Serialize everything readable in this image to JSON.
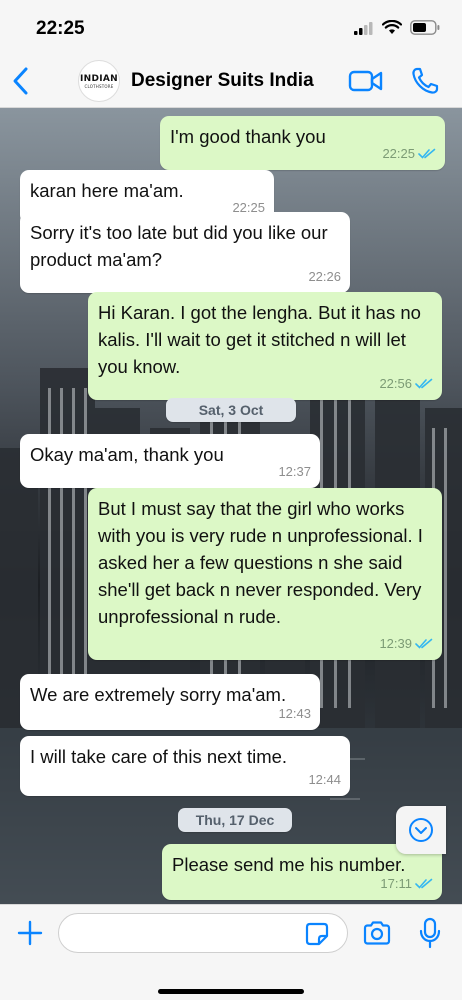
{
  "status_bar": {
    "time": "22:25"
  },
  "header": {
    "contact_name": "Designer Suits India",
    "avatar_line1": "INDIAN",
    "avatar_line2": "CLOTHSTORE"
  },
  "messages": [
    {
      "dir": "out",
      "text": "I'm good thank you",
      "time": "22:25",
      "read": true
    },
    {
      "dir": "in",
      "text": "karan here ma'am.",
      "time": "22:25"
    },
    {
      "dir": "in",
      "text": "Sorry it's too late but did you like our product ma'am?",
      "time": "22:26"
    },
    {
      "dir": "out",
      "text": "Hi Karan. I got the lengha. But it has no kalis. I'll wait to get it stitched n will let you know.",
      "time": "22:56",
      "read": true
    },
    {
      "dir": "date",
      "text": "Sat, 3 Oct"
    },
    {
      "dir": "in",
      "text": "Okay ma'am, thank you",
      "time": "12:37"
    },
    {
      "dir": "out",
      "text": "But I must say that the girl who works with you is very rude n unprofessional. I asked her a few questions n she said she'll get back n never responded. Very unprofessional n rude.",
      "time": "12:39",
      "read": true
    },
    {
      "dir": "in",
      "text": "We are extremely sorry ma'am.",
      "time": "12:43"
    },
    {
      "dir": "in",
      "text": "I will take care of this next time.",
      "time": "12:44"
    },
    {
      "dir": "date",
      "text": "Thu, 17 Dec"
    },
    {
      "dir": "out",
      "text": "Please send me his number.",
      "time": "17:11",
      "read": true
    }
  ],
  "input": {
    "placeholder": "",
    "value": ""
  },
  "colors": {
    "accent": "#0a84ff",
    "outgoing_bubble": "#dcf8c6",
    "incoming_bubble": "#ffffff",
    "read_tick": "#34b7f1"
  },
  "icons": {
    "back": "chevron-left-icon",
    "video": "video-camera-icon",
    "call": "phone-icon",
    "scroll": "chevron-down-circle-icon",
    "plus": "plus-icon",
    "sticker": "sticker-icon",
    "camera": "camera-icon",
    "mic": "microphone-icon"
  }
}
